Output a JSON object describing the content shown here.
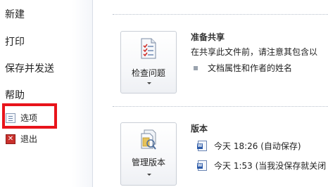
{
  "nav": {
    "new": "新建",
    "print": "打印",
    "save_send": "保存并发送",
    "help": "帮助",
    "options": "选项",
    "exit": "退出"
  },
  "inspect": {
    "button_label": "检查问题",
    "title": "准备共享",
    "description": "在共享此文件前，请注意其包含以",
    "bullet": "文档属性和作者的姓名"
  },
  "versions": {
    "button_label": "管理版本",
    "title": "版本",
    "items": [
      "今天 18:26 (自动保存)",
      "今天 1:53 (当我没保存就关闭"
    ]
  },
  "highlight_color": "#e8141b",
  "icons": {
    "options": "options-icon",
    "exit": "exit-icon",
    "inspect": "inspect-document-icon",
    "versions": "manage-versions-icon",
    "version_item": "word-document-icon"
  }
}
